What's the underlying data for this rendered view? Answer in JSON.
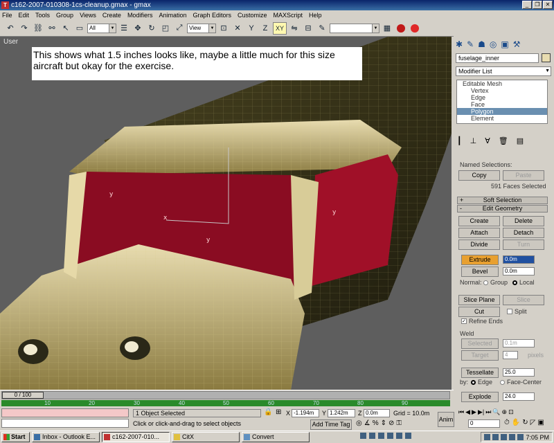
{
  "window": {
    "title": "c162-2007-010308-1cs-cleanup.gmax - gmax",
    "app_icon": "gmax-icon"
  },
  "menu": [
    "File",
    "Edit",
    "Tools",
    "Group",
    "Views",
    "Create",
    "Modifiers",
    "Animation",
    "Graph Editors",
    "Customize",
    "MAXScript",
    "Help"
  ],
  "toolbar": {
    "selection_filter": "All",
    "ref_coord": "View",
    "axis_xy": "XY",
    "named_sel": ""
  },
  "viewport": {
    "label": "User",
    "note": "This shows what 1.5 inches looks like, maybe a little much for this size aircraft but okay for the exercise."
  },
  "command_panel": {
    "object_name": "fuselage_inner",
    "modifier_list": "Modifier List",
    "stack": [
      {
        "label": "Editable Mesh",
        "selected": false
      },
      {
        "label": "Vertex",
        "selected": false
      },
      {
        "label": "Edge",
        "selected": false
      },
      {
        "label": "Face",
        "selected": false
      },
      {
        "label": "Polygon",
        "selected": true
      },
      {
        "label": "Element",
        "selected": false
      }
    ],
    "named_selections": {
      "title": "Named Selections:",
      "copy": "Copy",
      "paste": "Paste",
      "faces_selected": "591 Faces Selected"
    },
    "soft_selection": "Soft Selection",
    "edit_geometry": {
      "title": "Edit Geometry",
      "create": "Create",
      "delete": "Delete",
      "attach": "Attach",
      "detach": "Detach",
      "divide": "Divide",
      "turn": "Turn",
      "extrude": "Extrude",
      "extrude_value": "0.0m",
      "bevel": "Bevel",
      "bevel_value": "0.0m",
      "normal_label": "Normal:",
      "group": "Group",
      "local": "Local",
      "slice_plane": "Slice Plane",
      "slice": "Slice",
      "cut": "Cut",
      "split": "Split",
      "refine_ends": "Refine Ends",
      "weld": "Weld",
      "weld_selected": "Selected",
      "weld_selected_value": "0.1m",
      "weld_target": "Target",
      "weld_target_value": "4",
      "pixels": "pixels",
      "tessellate": "Tessellate",
      "tessellate_value": "25.0",
      "by_label": "by:",
      "edge": "Edge",
      "face_center": "Face-Center",
      "explode": "Explode",
      "explode_value": "24.0"
    }
  },
  "timeline": {
    "frame": "0 / 100",
    "ticks": [
      "10",
      "20",
      "30",
      "40",
      "50",
      "60",
      "70",
      "80",
      "90"
    ]
  },
  "status": {
    "objects": "1 Object Selected",
    "prompt": "Click or click-and-drag to select objects",
    "x_label": "X",
    "x": "-1.194m",
    "y_label": "Y",
    "y": "1.242m",
    "z_label": "Z",
    "z": "0.0m",
    "grid": "Grid = 10.0m",
    "add_time_tag": "Add Time Tag",
    "anim": "Anim",
    "frame_field": "0"
  },
  "taskbar": {
    "start": "Start",
    "tasks": [
      "Inbox - Outlook E...",
      "c162-2007-010...",
      "CitX",
      "Convert"
    ],
    "clock": "7:05 PM"
  }
}
